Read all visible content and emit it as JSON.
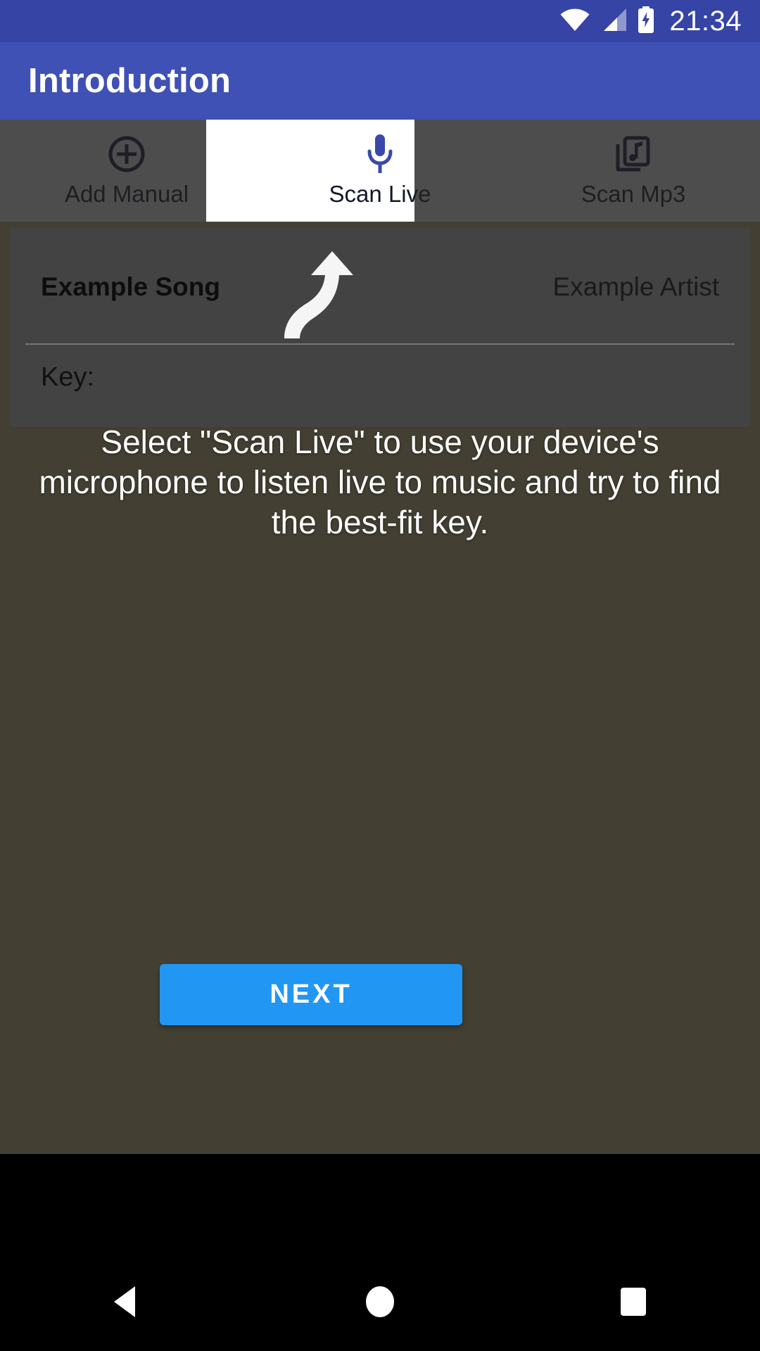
{
  "status_bar": {
    "time": "21:34",
    "icons": [
      "wifi-icon",
      "cell-signal-icon",
      "battery-charging-icon"
    ],
    "background_color": "#3544A5"
  },
  "toolbar": {
    "title": "Introduction",
    "background_color": "#3F51B5",
    "text_color": "#FFFFFF"
  },
  "tabs": [
    {
      "label": "Add Manual",
      "icon": "plus-circle-icon",
      "selected": false
    },
    {
      "label": "Scan Live",
      "icon": "microphone-icon",
      "selected": true
    },
    {
      "label": "Scan Mp3",
      "icon": "music-library-icon",
      "selected": false
    }
  ],
  "card": {
    "song_title": "Example Song",
    "artist": "Example Artist",
    "key_label": "Key:"
  },
  "coach_mark": {
    "instruction": "Select \"Scan Live\" to use your device's microphone to listen live to music and try to find the best-fit key.",
    "arrow": "curved-up-arrow-icon",
    "highlight_target": "Scan Live",
    "scrim_color": "#212121",
    "text_color": "#FFFFFF"
  },
  "footer": {
    "next_label": "NEXT",
    "next_color": "#2196F3"
  },
  "nav_bar": {
    "back": "back-triangle-icon",
    "home": "home-circle-icon",
    "recents": "recents-square-icon",
    "background_color": "#000000"
  },
  "theme": {
    "accent": "#3F51B5",
    "background": "#3D3A2C",
    "icon_dark": "#141A3C"
  }
}
